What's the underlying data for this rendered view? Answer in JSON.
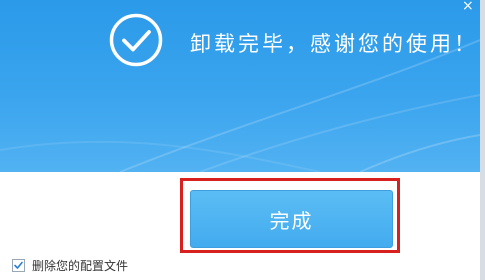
{
  "banner": {
    "message": "卸载完毕，感谢您的使用！",
    "icon": "checkmark-circle-icon",
    "close_icon": "close-icon",
    "close_glyph": "×"
  },
  "actions": {
    "finish_label": "完成"
  },
  "options": {
    "delete_config": {
      "label": "删除您的配置文件",
      "checked": true
    }
  },
  "colors": {
    "banner": "#3aa4ee",
    "button": "#4fb4f2",
    "highlight": "#d8201f"
  }
}
